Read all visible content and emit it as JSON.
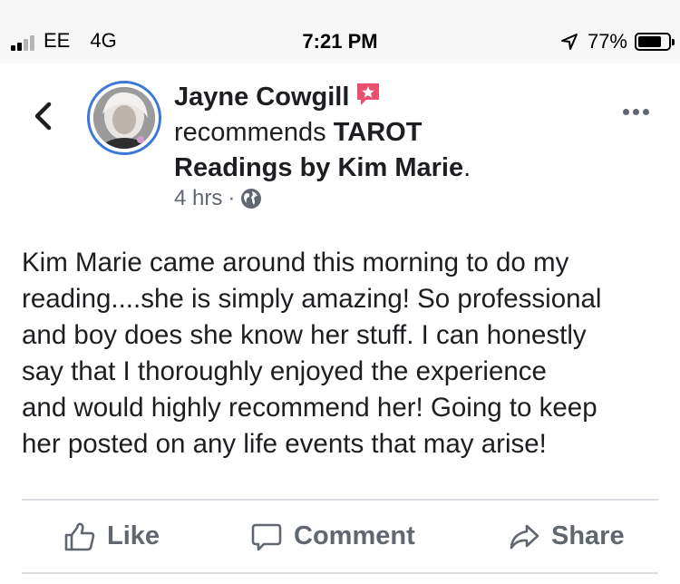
{
  "status_bar": {
    "carrier": "EE",
    "network": "4G",
    "time": "7:21 PM",
    "battery_percent": "77%",
    "battery_level": 0.77,
    "signal_bars_active": 2,
    "signal_bars_total": 4
  },
  "post": {
    "author": "Jayne Cowgill",
    "recommends_text": "recommends",
    "page_name_line1": "TAROT",
    "page_name_line2": "Readings by Kim Marie",
    "period": ".",
    "time_ago": "4 hrs",
    "separator": "·",
    "privacy_icon": "globe-icon",
    "body": "Kim Marie came around this morning to do my\nreading....she is simply amazing! So professional\nand boy does she know her stuff. I can honestly\nsay that I thoroughly enjoyed the experience\nand would highly recommend her! Going to keep\nher posted on any life events that may arise!"
  },
  "actions": {
    "like_label": "Like",
    "comment_label": "Comment",
    "share_label": "Share"
  },
  "colors": {
    "recommend_badge": "#e8506e",
    "avatar_ring": "#3b78d8",
    "secondary_text": "#606770"
  }
}
